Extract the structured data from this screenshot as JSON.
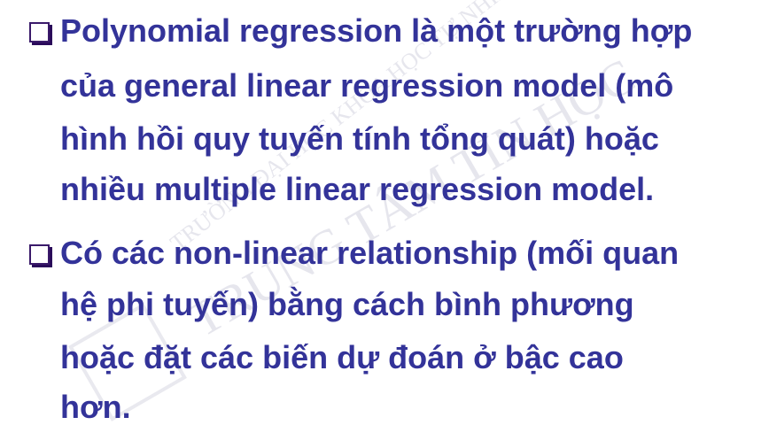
{
  "watermark": {
    "line1": "TRƯỜNG ĐẠI HỌC KHOA HỌC TỰ NHIÊN",
    "line2": "TRUNG TÂM TIN HỌC"
  },
  "bullets": [
    {
      "icon": "hollow-square-bullet",
      "lines": [
        "Polynomial regression là một trường hợp",
        "của general linear regression model (mô",
        "hình hồi quy tuyến tính tổng quát) hoặc",
        "nhiều multiple linear regression model."
      ]
    },
    {
      "icon": "hollow-square-bullet",
      "lines": [
        "Có các non-linear relationship (mối quan",
        "hệ phi tuyến) bằng cách bình phương",
        "hoặc đặt các biến dự đoán ở bậc cao",
        "hơn."
      ]
    }
  ],
  "colors": {
    "text": "#333399",
    "bullet": "#3a1a6a"
  }
}
